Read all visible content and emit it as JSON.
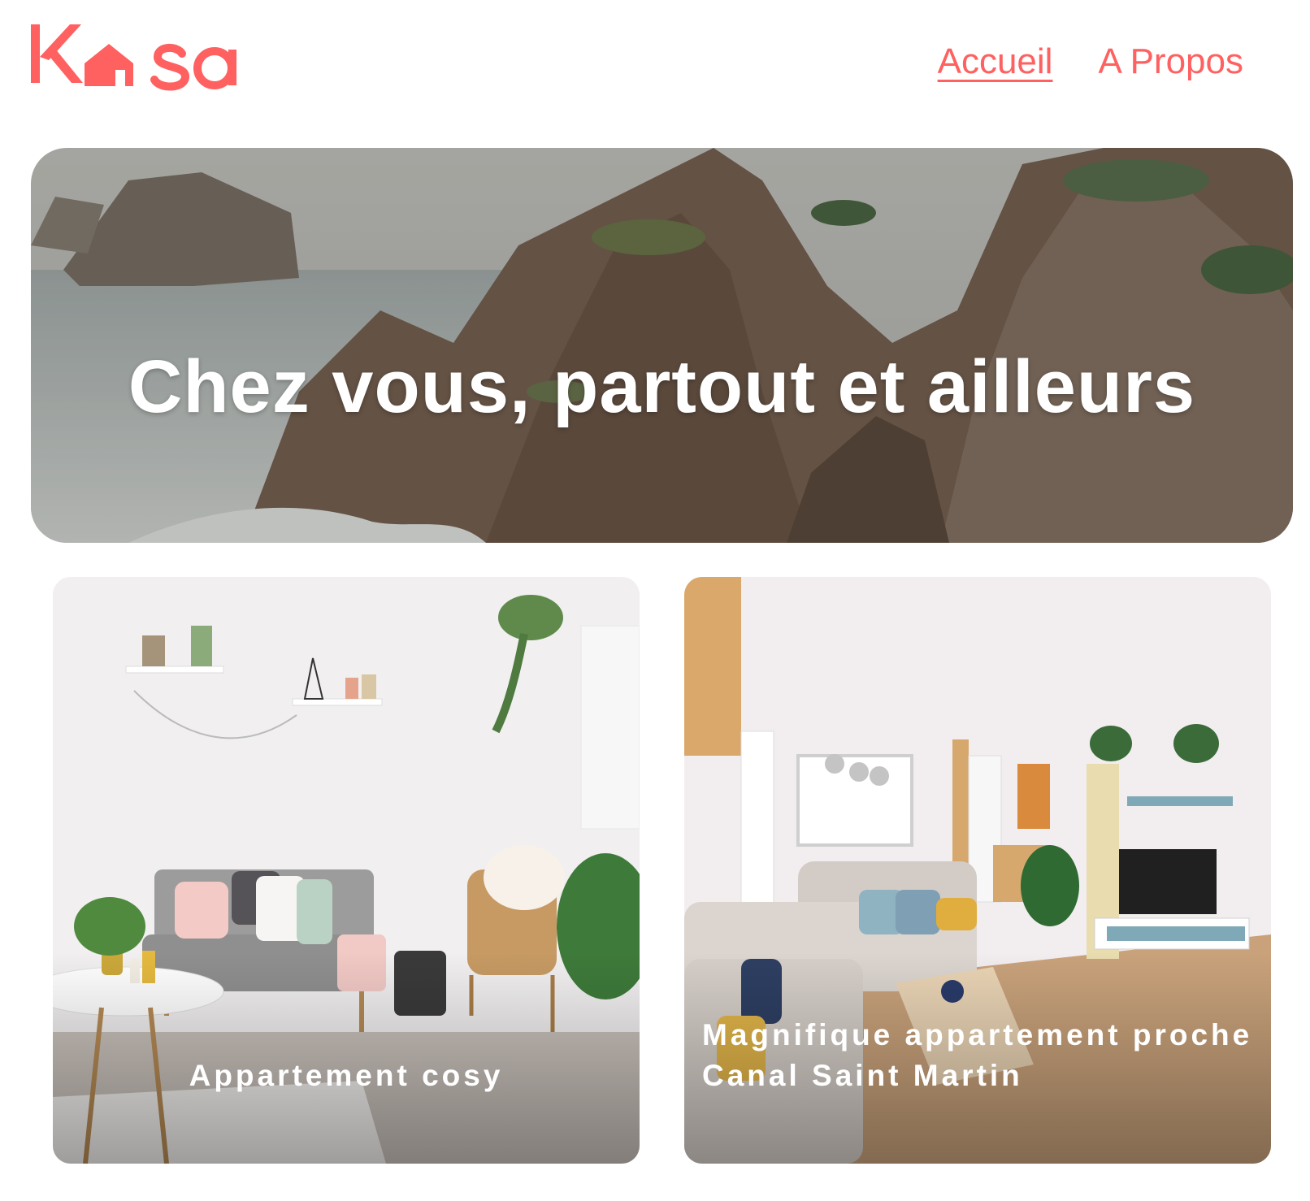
{
  "header": {
    "logo_text": "Kasa",
    "nav": [
      {
        "label": "Accueil",
        "active": true
      },
      {
        "label": "A Propos",
        "active": false
      }
    ]
  },
  "banner": {
    "title": "Chez vous, partout et ailleurs"
  },
  "listings": [
    {
      "title": "Appartement cosy"
    },
    {
      "title": "Magnifique appartement proche Canal Saint Martin"
    }
  ],
  "colors": {
    "accent": "#FF6060",
    "text_on_image": "#FFFFFF",
    "background": "#FFFFFF"
  }
}
